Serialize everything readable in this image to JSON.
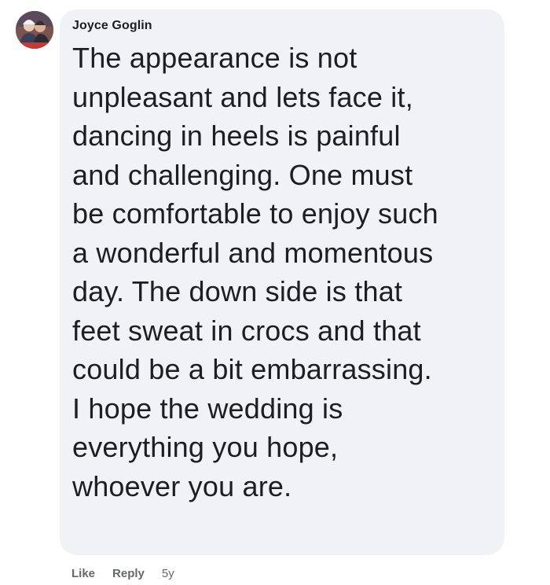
{
  "comment": {
    "author": "Joyce Goglin",
    "avatar_icon": "user-avatar-photo",
    "lines": [
      "The appearance is not",
      "unpleasant and lets face it,",
      "dancing in heels is painful",
      "and challenging. One must",
      "be comfortable to enjoy such",
      "a wonderful and momentous",
      "day. The down side is that",
      "feet sweat in crocs and that",
      "could be a bit embarrassing.",
      "I hope the wedding is",
      "everything you hope,",
      "whoever you are."
    ],
    "actions": {
      "like_label": "Like",
      "reply_label": "Reply",
      "timestamp": "5y"
    }
  },
  "colors": {
    "bubble_background": "#f0f2f5",
    "text_primary": "#1c1e21",
    "text_secondary": "#65676b"
  }
}
